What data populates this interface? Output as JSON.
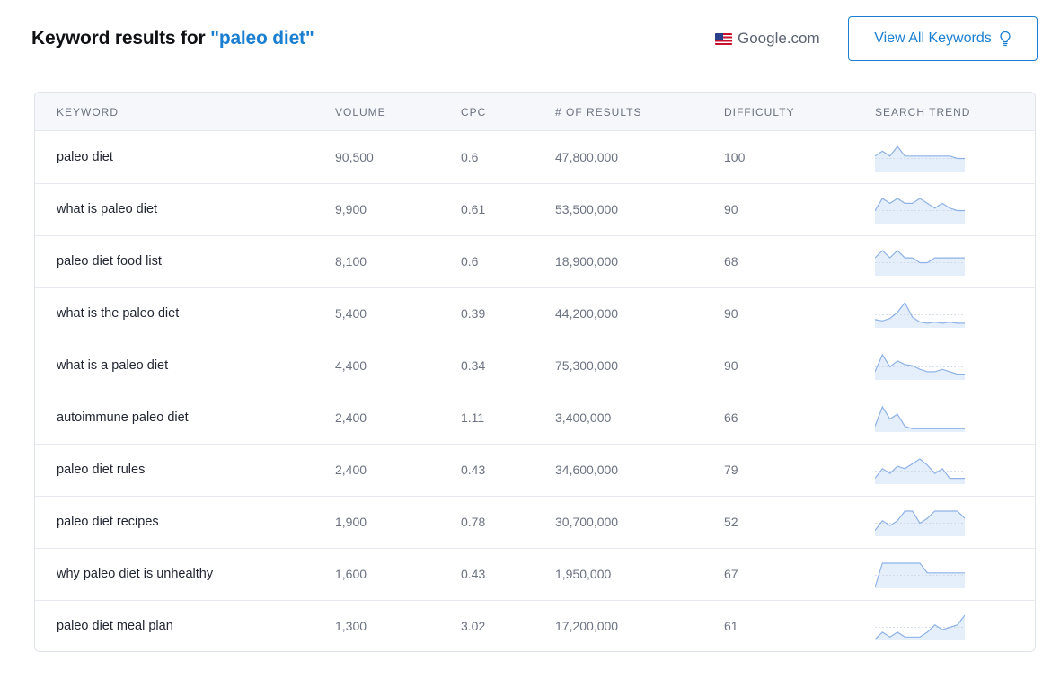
{
  "header": {
    "title_prefix": "Keyword results for ",
    "query": "\"paleo diet\"",
    "engine_label": "Google.com",
    "engine_flag_icon": "us-flag-icon",
    "view_all_label": "View All Keywords",
    "view_all_icon": "lightbulb-icon"
  },
  "colors": {
    "accent": "#1b7fd1",
    "trend_line": "#8fb2e6",
    "trend_fill": "#e5eefb"
  },
  "table": {
    "columns": [
      "KEYWORD",
      "VOLUME",
      "CPC",
      "# OF RESULTS",
      "DIFFICULTY",
      "SEARCH TREND"
    ],
    "rows": [
      {
        "keyword": "paleo diet",
        "volume": "90,500",
        "cpc": "0.6",
        "results": "47,800,000",
        "difficulty": "100",
        "trend": [
          0.6,
          0.8,
          0.6,
          1.0,
          0.6,
          0.6,
          0.6,
          0.6,
          0.6,
          0.6,
          0.6,
          0.5,
          0.5
        ]
      },
      {
        "keyword": "what is paleo diet",
        "volume": "9,900",
        "cpc": "0.61",
        "results": "53,500,000",
        "difficulty": "90",
        "trend": [
          0.5,
          1.0,
          0.8,
          1.0,
          0.8,
          0.8,
          1.0,
          0.8,
          0.6,
          0.8,
          0.6,
          0.5,
          0.5
        ]
      },
      {
        "keyword": "paleo diet food list",
        "volume": "8,100",
        "cpc": "0.6",
        "results": "18,900,000",
        "difficulty": "68",
        "trend": [
          0.7,
          1.0,
          0.7,
          1.0,
          0.7,
          0.7,
          0.5,
          0.5,
          0.7,
          0.7,
          0.7,
          0.7,
          0.7
        ]
      },
      {
        "keyword": "what is the paleo diet",
        "volume": "5,400",
        "cpc": "0.39",
        "results": "44,200,000",
        "difficulty": "90",
        "trend": [
          0.3,
          0.25,
          0.35,
          0.6,
          1.0,
          0.4,
          0.2,
          0.15,
          0.2,
          0.15,
          0.2,
          0.15,
          0.15
        ]
      },
      {
        "keyword": "what is a paleo diet",
        "volume": "4,400",
        "cpc": "0.34",
        "results": "75,300,000",
        "difficulty": "90",
        "trend": [
          0.3,
          1.0,
          0.5,
          0.75,
          0.6,
          0.55,
          0.4,
          0.3,
          0.3,
          0.4,
          0.3,
          0.2,
          0.2
        ]
      },
      {
        "keyword": "autoimmune paleo diet",
        "volume": "2,400",
        "cpc": "1.11",
        "results": "3,400,000",
        "difficulty": "66",
        "trend": [
          0.2,
          1.0,
          0.5,
          0.7,
          0.2,
          0.1,
          0.1,
          0.1,
          0.1,
          0.1,
          0.1,
          0.1,
          0.1
        ]
      },
      {
        "keyword": "paleo diet rules",
        "volume": "2,400",
        "cpc": "0.43",
        "results": "34,600,000",
        "difficulty": "79",
        "trend": [
          0.2,
          0.6,
          0.4,
          0.7,
          0.6,
          0.8,
          1.0,
          0.75,
          0.4,
          0.6,
          0.2,
          0.2,
          0.2
        ]
      },
      {
        "keyword": "paleo diet recipes",
        "volume": "1,900",
        "cpc": "0.78",
        "results": "30,700,000",
        "difficulty": "52",
        "trend": [
          0.2,
          0.6,
          0.4,
          0.6,
          1.0,
          1.0,
          0.5,
          0.7,
          1.0,
          1.0,
          1.0,
          1.0,
          0.7
        ]
      },
      {
        "keyword": "why paleo diet is unhealthy",
        "volume": "1,600",
        "cpc": "0.43",
        "results": "1,950,000",
        "difficulty": "67",
        "trend": [
          0.0,
          1.0,
          1.0,
          1.0,
          1.0,
          1.0,
          1.0,
          0.6,
          0.6,
          0.6,
          0.6,
          0.6,
          0.6
        ]
      },
      {
        "keyword": "paleo diet meal plan",
        "volume": "1,300",
        "cpc": "3.02",
        "results": "17,200,000",
        "difficulty": "61",
        "trend": [
          0.0,
          0.3,
          0.1,
          0.3,
          0.1,
          0.1,
          0.1,
          0.3,
          0.6,
          0.4,
          0.5,
          0.6,
          1.0
        ]
      }
    ]
  }
}
